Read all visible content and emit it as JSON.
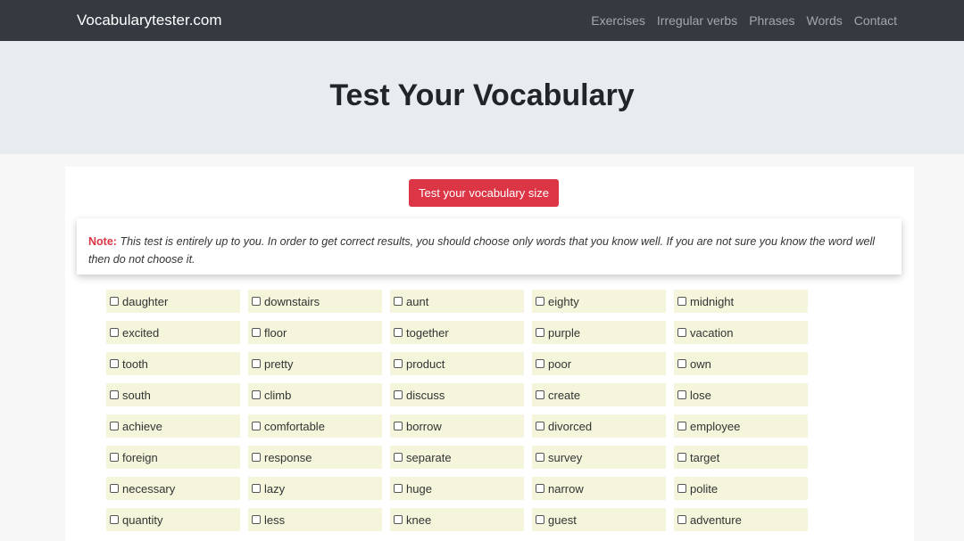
{
  "navbar": {
    "brand": "Vocabularytester.com",
    "links": [
      "Exercises",
      "Irregular verbs",
      "Phrases",
      "Words",
      "Contact"
    ]
  },
  "hero": {
    "title": "Test Your Vocabulary"
  },
  "test_button": "Test your vocabulary size",
  "note": {
    "label": "Note:",
    "text": "This test is entirely up to you. In order to get correct results, you should choose only words that you know well. If you are not sure you know the word well then do not choose it."
  },
  "words": [
    "daughter",
    "downstairs",
    "aunt",
    "eighty",
    "midnight",
    "excited",
    "floor",
    "together",
    "purple",
    "vacation",
    "tooth",
    "pretty",
    "product",
    "poor",
    "own",
    "south",
    "climb",
    "discuss",
    "create",
    "lose",
    "achieve",
    "comfortable",
    "borrow",
    "divorced",
    "employee",
    "foreign",
    "response",
    "separate",
    "survey",
    "target",
    "necessary",
    "lazy",
    "huge",
    "narrow",
    "polite",
    "quantity",
    "less",
    "knee",
    "guest",
    "adventure"
  ],
  "colors": {
    "navbar": "#343a40",
    "hero": "#e9ecef",
    "button": "#dc3545",
    "word_bg": "#f5f5dc"
  }
}
